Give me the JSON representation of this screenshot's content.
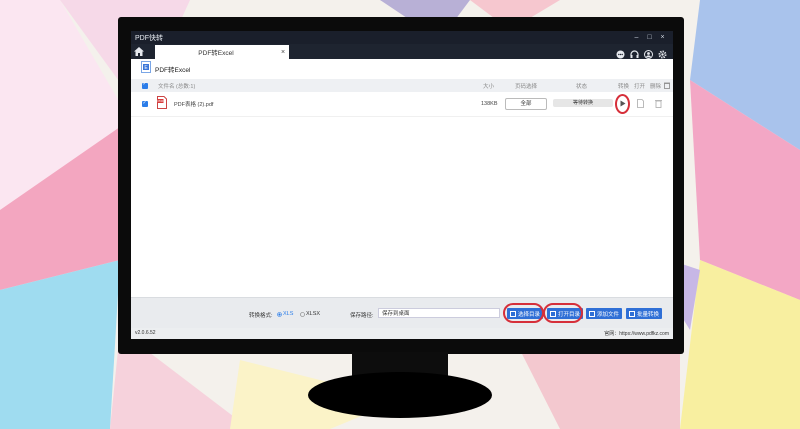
{
  "app": {
    "title": "PDF快转",
    "version": "v2.0.6.52",
    "website": "官网：https://www.pdfkz.com"
  },
  "window_controls": {
    "minimize": "–",
    "maximize": "□",
    "close": "×"
  },
  "tab": {
    "label": "PDF转Excel",
    "close": "×"
  },
  "section": {
    "title": "PDF转Excel"
  },
  "table": {
    "headers": {
      "name": "文件名 (总数:1)",
      "size": "大小",
      "pages": "页码选择",
      "status": "状态",
      "convert": "转换",
      "open": "打开",
      "delete": "删除"
    },
    "rows": [
      {
        "name": "PDF表格 (2).pdf",
        "size": "138KB",
        "pages": "全部",
        "status": "等待转换"
      }
    ]
  },
  "footer": {
    "format_label": "转换格式:",
    "format_options": [
      "XLS",
      "XLSX"
    ],
    "format_selected": "XLS",
    "save_label": "保存路径:",
    "save_value": "保存到桌面",
    "buttons": {
      "choose_dir": "选择目录",
      "open_dir": "打开目录",
      "add_file": "添加文件",
      "batch_convert": "批量转换"
    }
  },
  "colors": {
    "accent": "#2f6fd6",
    "highlight_ring": "#d62f3a",
    "titlebar": "#1a1f2b"
  }
}
